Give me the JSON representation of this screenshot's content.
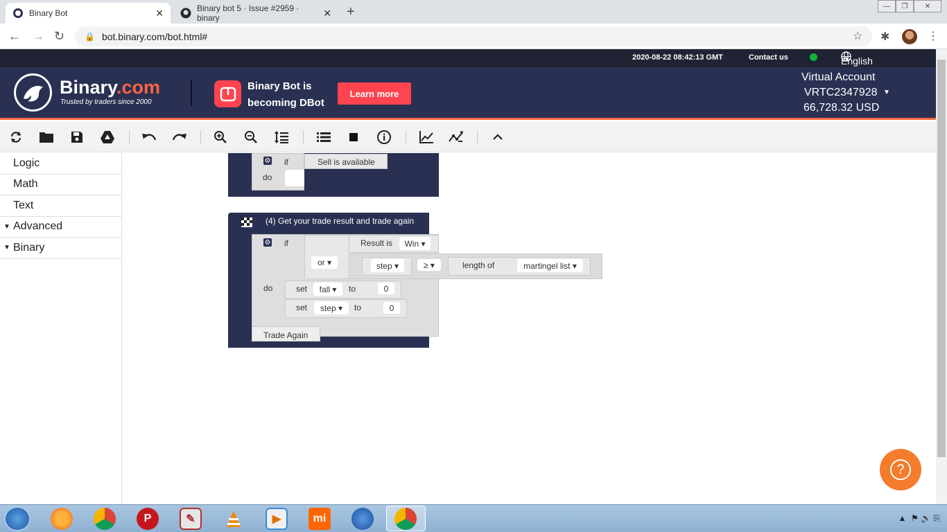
{
  "browser": {
    "tabs": [
      {
        "title": "Binary Bot",
        "close": "✕"
      },
      {
        "title": "Binary bot 5 · Issue #2959 · binary",
        "close": "✕"
      }
    ],
    "new_tab": "+",
    "url": "bot.binary.com/bot.html#"
  },
  "site": {
    "datetime": "2020-08-22 08:42:13 GMT",
    "contact": "Contact us",
    "language": "English",
    "logo_main": "Binary",
    "logo_dot": ".com",
    "logo_tagline": "Trusted by traders since 2000",
    "promo_line1": "Binary Bot is",
    "promo_line2": "becoming DBot",
    "learn_more": "Learn more",
    "account_type": "Virtual Account",
    "account_id": "VRTC2347928",
    "balance": "66,728.32 USD",
    "brand_color": "#2a3052",
    "accent_color": "#ff6444"
  },
  "toolbar": {
    "icons": [
      "reset-icon",
      "open-icon",
      "save-icon",
      "drive-icon",
      "undo-icon",
      "redo-icon",
      "zoom-in-icon",
      "zoom-out-icon",
      "rearrange-icon",
      "summary-icon",
      "stop-icon",
      "info-icon",
      "chart-icon",
      "tradingview-icon",
      "collapse-icon"
    ]
  },
  "sidebar": {
    "items": [
      {
        "label": "Logic",
        "arrow": ""
      },
      {
        "label": "Math",
        "arrow": ""
      },
      {
        "label": "Text",
        "arrow": ""
      },
      {
        "label": "Advanced",
        "arrow": "▼"
      },
      {
        "label": "Binary",
        "arrow": "▼"
      }
    ]
  },
  "blocks": {
    "block1": {
      "if": "if",
      "condition": "Sell is available",
      "do": "do"
    },
    "block2": {
      "title": "(4) Get your trade result and trade again",
      "if": "if",
      "result_is": "Result is",
      "result_value": "Win ▾",
      "or": "or ▾",
      "step_var": "step ▾",
      "op": "≥ ▾",
      "length_of": "length of",
      "list_var": "martingel list ▾",
      "do": "do",
      "set1": "set",
      "set1_var": "fall ▾",
      "set1_to": "to",
      "set1_value": "0",
      "set2": "set",
      "set2_var": "step ▾",
      "set2_to": "to",
      "set2_value": "0",
      "trade_again": "Trade Again"
    }
  },
  "help": "?"
}
